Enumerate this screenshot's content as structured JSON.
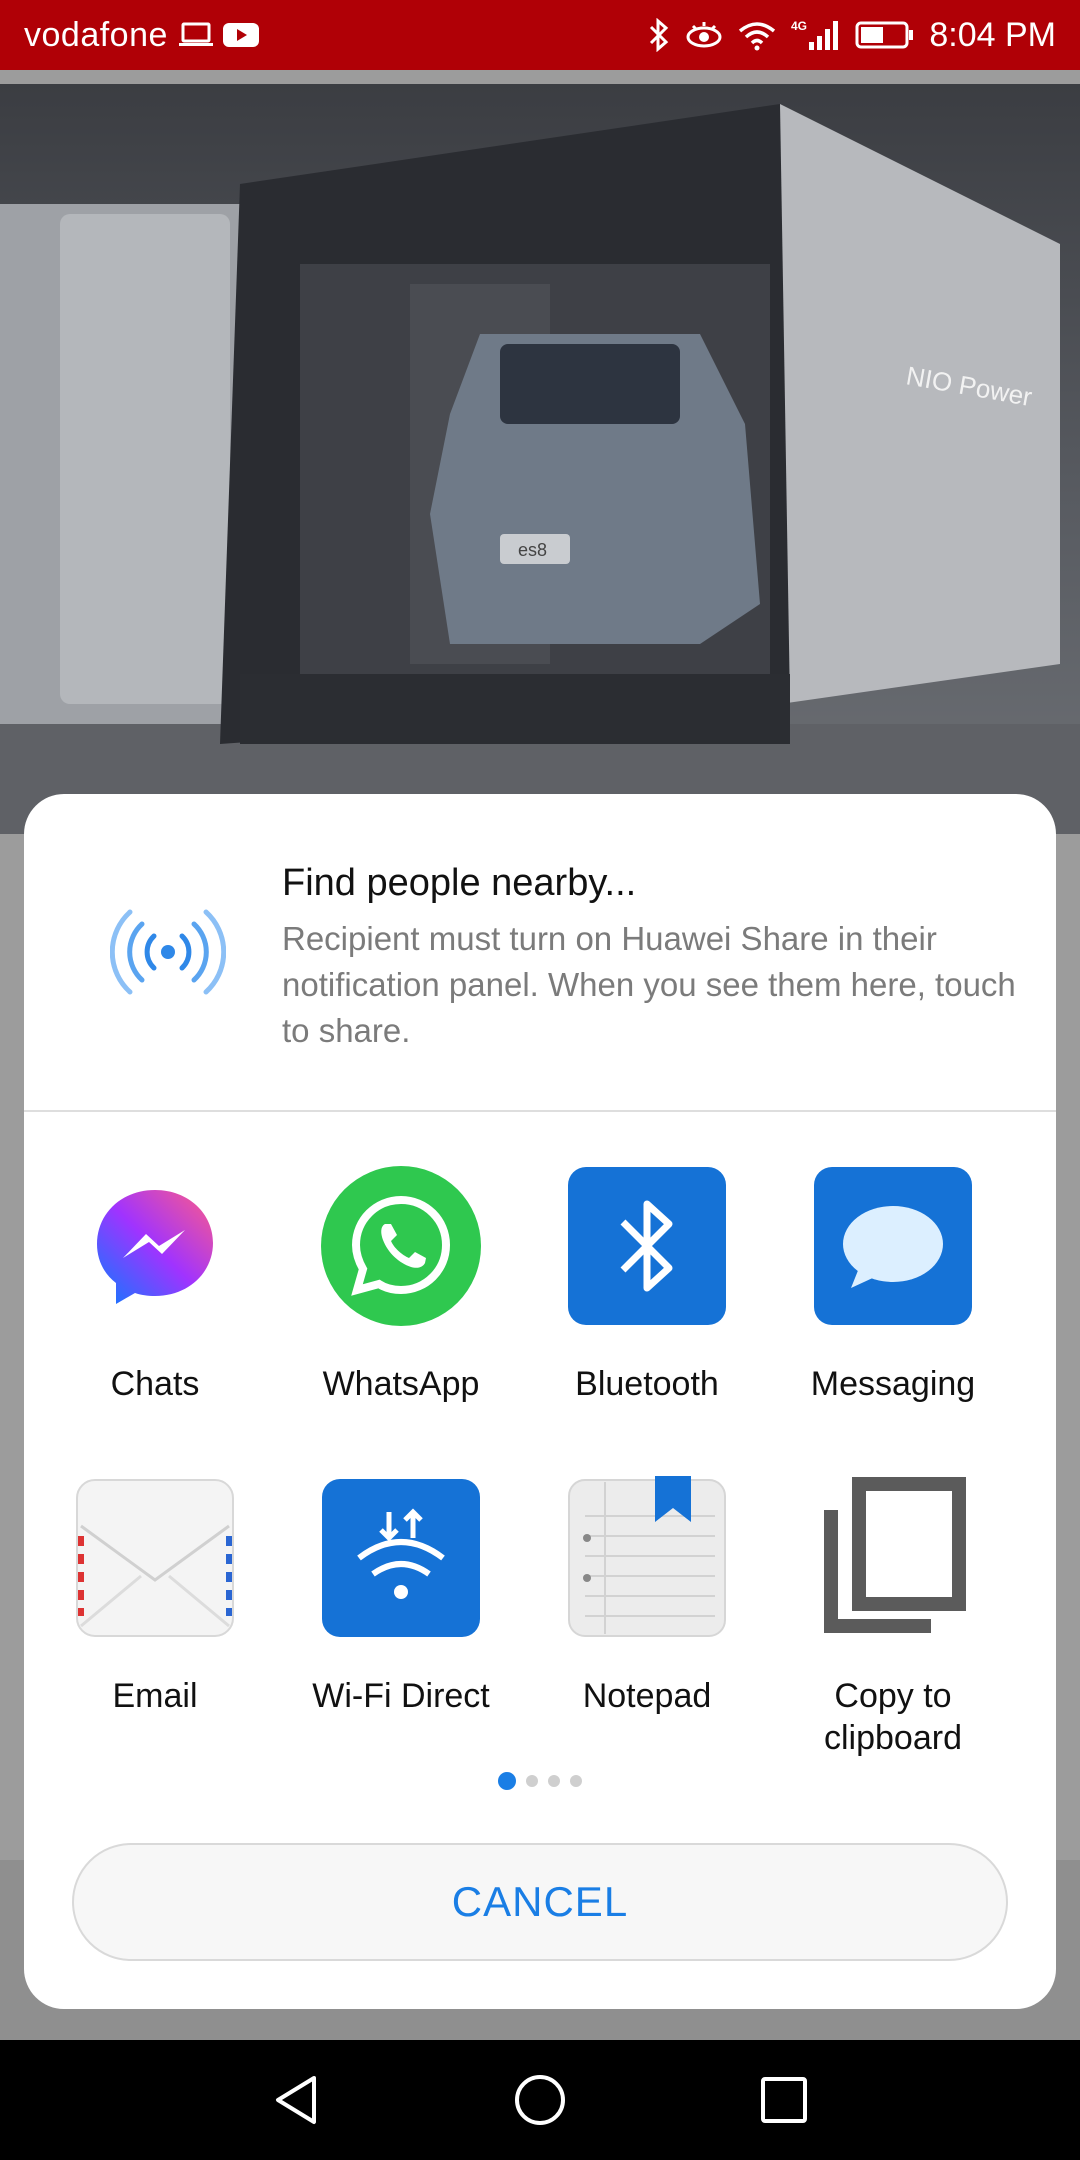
{
  "status_bar": {
    "carrier": "vodafone",
    "time": "8:04 PM",
    "icons_left": [
      "laptop-icon",
      "youtube-icon"
    ],
    "icons_right": [
      "bluetooth-icon",
      "eye-comfort-icon",
      "wifi-icon",
      "4g-signal-icon",
      "battery-icon"
    ],
    "network_label": "4G",
    "background_color": "#b00006"
  },
  "hero": {
    "sign_text": "NIO Power",
    "plate_text": "es8"
  },
  "share_sheet": {
    "nearby": {
      "title": "Find people nearby...",
      "description": "Recipient must turn on Huawei Share in their notification panel. When you see them here, touch to share.",
      "icon": "huawei-share-icon"
    },
    "apps": [
      {
        "label": "Chats",
        "icon": "messenger-icon"
      },
      {
        "label": "WhatsApp",
        "icon": "whatsapp-icon"
      },
      {
        "label": "Bluetooth",
        "icon": "bluetooth-icon"
      },
      {
        "label": "Messaging",
        "icon": "messaging-icon"
      },
      {
        "label": "Email",
        "icon": "email-icon"
      },
      {
        "label": "Wi-Fi Direct",
        "icon": "wifi-direct-icon"
      },
      {
        "label": "Notepad",
        "icon": "notepad-icon"
      },
      {
        "label": "Copy to clipboard",
        "icon": "copy-icon"
      }
    ],
    "page_indicator": {
      "pages": 4,
      "current": 1
    },
    "cancel_label": "CANCEL",
    "accent_color": "#1a7ee5"
  },
  "nav_bar": {
    "buttons": [
      "back-icon",
      "home-icon",
      "recents-icon"
    ]
  }
}
